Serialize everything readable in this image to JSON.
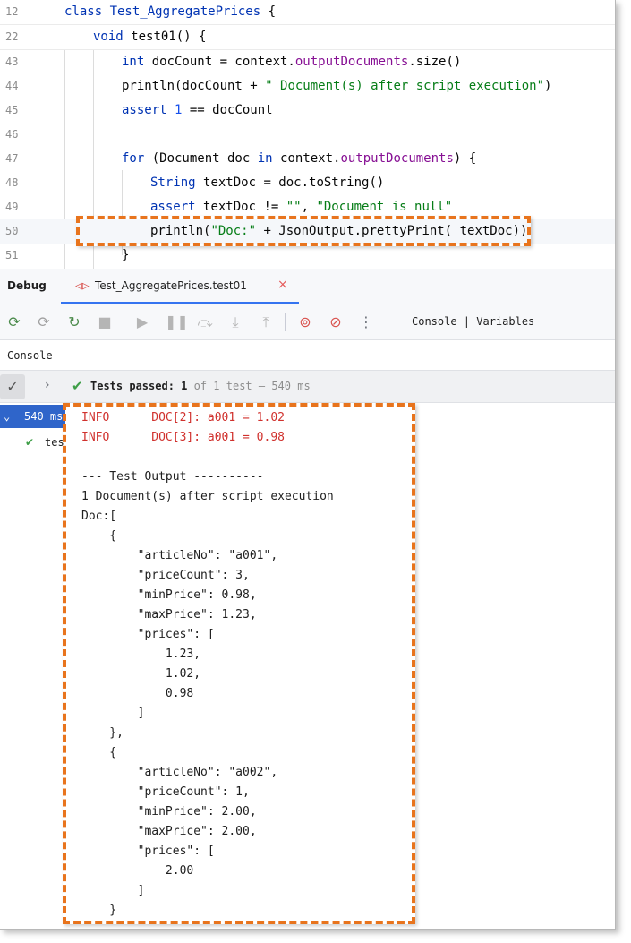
{
  "editor": {
    "sticky": [
      {
        "ln": "12",
        "tokens": [
          {
            "t": "class ",
            "c": "kw"
          },
          {
            "t": "Test_AggregatePrices",
            "c": "typ"
          },
          {
            "t": " {",
            "c": "cls"
          }
        ]
      },
      {
        "ln": "22",
        "tokens": [
          {
            "t": "void ",
            "c": "kw"
          },
          {
            "t": "test01() {",
            "c": "cls"
          }
        ]
      }
    ],
    "lines": [
      {
        "ln": "43",
        "tokens": [
          {
            "t": "int ",
            "c": "kw"
          },
          {
            "t": "docCount = context.",
            "c": "cls"
          },
          {
            "t": "outputDocuments",
            "c": "fld"
          },
          {
            "t": ".size()",
            "c": "cls"
          }
        ]
      },
      {
        "ln": "44",
        "tokens": [
          {
            "t": "println(docCount + ",
            "c": "cls"
          },
          {
            "t": "\" Document(s) after script execution\"",
            "c": "str"
          },
          {
            "t": ")",
            "c": "cls"
          }
        ]
      },
      {
        "ln": "45",
        "tokens": [
          {
            "t": "assert ",
            "c": "kw"
          },
          {
            "t": "1",
            "c": "num"
          },
          {
            "t": " == docCount",
            "c": "cls"
          }
        ]
      },
      {
        "ln": "46",
        "tokens": []
      },
      {
        "ln": "47",
        "tokens": [
          {
            "t": "for ",
            "c": "kw"
          },
          {
            "t": "(Document doc ",
            "c": "cls"
          },
          {
            "t": "in ",
            "c": "kw"
          },
          {
            "t": "context.",
            "c": "cls"
          },
          {
            "t": "outputDocuments",
            "c": "fld"
          },
          {
            "t": ") {",
            "c": "cls"
          }
        ]
      },
      {
        "ln": "48",
        "tokens": [
          {
            "t": "String ",
            "c": "typ"
          },
          {
            "t": "textDoc = doc.toString()",
            "c": "cls"
          }
        ]
      },
      {
        "ln": "49",
        "tokens": [
          {
            "t": "assert ",
            "c": "kw"
          },
          {
            "t": "textDoc != ",
            "c": "cls"
          },
          {
            "t": "\"\"",
            "c": "str"
          },
          {
            "t": ", ",
            "c": "cls"
          },
          {
            "t": "\"Document is null\"",
            "c": "str"
          }
        ]
      },
      {
        "ln": "50",
        "tokens": [
          {
            "t": "println(",
            "c": "cls"
          },
          {
            "t": "\"Doc:\"",
            "c": "str"
          },
          {
            "t": " + JsonOutput.prettyPrint( textDoc))",
            "c": "cls"
          }
        ]
      },
      {
        "ln": "51",
        "tokens": [
          {
            "t": "}",
            "c": "cls"
          }
        ]
      }
    ]
  },
  "debug": {
    "title": "Debug",
    "tab_label": "Test_AggregatePrices.test01",
    "tab_close": "×"
  },
  "toolbar": {
    "views_label": "Console | Variables",
    "icons": [
      "rerun-icon",
      "rerun-failed-icon",
      "rerun-debug-icon",
      "stop-icon",
      "resume-icon",
      "pause-icon",
      "step-over-icon",
      "step-into-icon",
      "step-out-icon",
      "view-breakpoints-icon",
      "mute-breakpoints-icon",
      "more-icon"
    ]
  },
  "console_header": {
    "label": "Console"
  },
  "tests_bar": {
    "passed_label": "Tests passed:",
    "passed_count": "1",
    "total_text": "of 1 test – 540 ms"
  },
  "tree": {
    "root_label": "540 ms",
    "child_label": "tes"
  },
  "console_output": [
    {
      "text": "INFO      DOC[2]: a001 = 1.02",
      "info": true
    },
    {
      "text": "INFO      DOC[3]: a001 = 0.98",
      "info": true
    },
    {
      "text": "",
      "info": false
    },
    {
      "text": "--- Test Output ----------",
      "info": false
    },
    {
      "text": "1 Document(s) after script execution",
      "info": false
    },
    {
      "text": "Doc:[",
      "info": false
    },
    {
      "text": "    {",
      "info": false
    },
    {
      "text": "        \"articleNo\": \"a001\",",
      "info": false
    },
    {
      "text": "        \"priceCount\": 3,",
      "info": false
    },
    {
      "text": "        \"minPrice\": 0.98,",
      "info": false
    },
    {
      "text": "        \"maxPrice\": 1.23,",
      "info": false
    },
    {
      "text": "        \"prices\": [",
      "info": false
    },
    {
      "text": "            1.23,",
      "info": false
    },
    {
      "text": "            1.02,",
      "info": false
    },
    {
      "text": "            0.98",
      "info": false
    },
    {
      "text": "        ]",
      "info": false
    },
    {
      "text": "    },",
      "info": false
    },
    {
      "text": "    {",
      "info": false
    },
    {
      "text": "        \"articleNo\": \"a002\",",
      "info": false
    },
    {
      "text": "        \"priceCount\": 1,",
      "info": false
    },
    {
      "text": "        \"minPrice\": 2.00,",
      "info": false
    },
    {
      "text": "        \"maxPrice\": 2.00,",
      "info": false
    },
    {
      "text": "        \"prices\": [",
      "info": false
    },
    {
      "text": "            2.00",
      "info": false
    },
    {
      "text": "        ]",
      "info": false
    },
    {
      "text": "    }",
      "info": false
    }
  ]
}
